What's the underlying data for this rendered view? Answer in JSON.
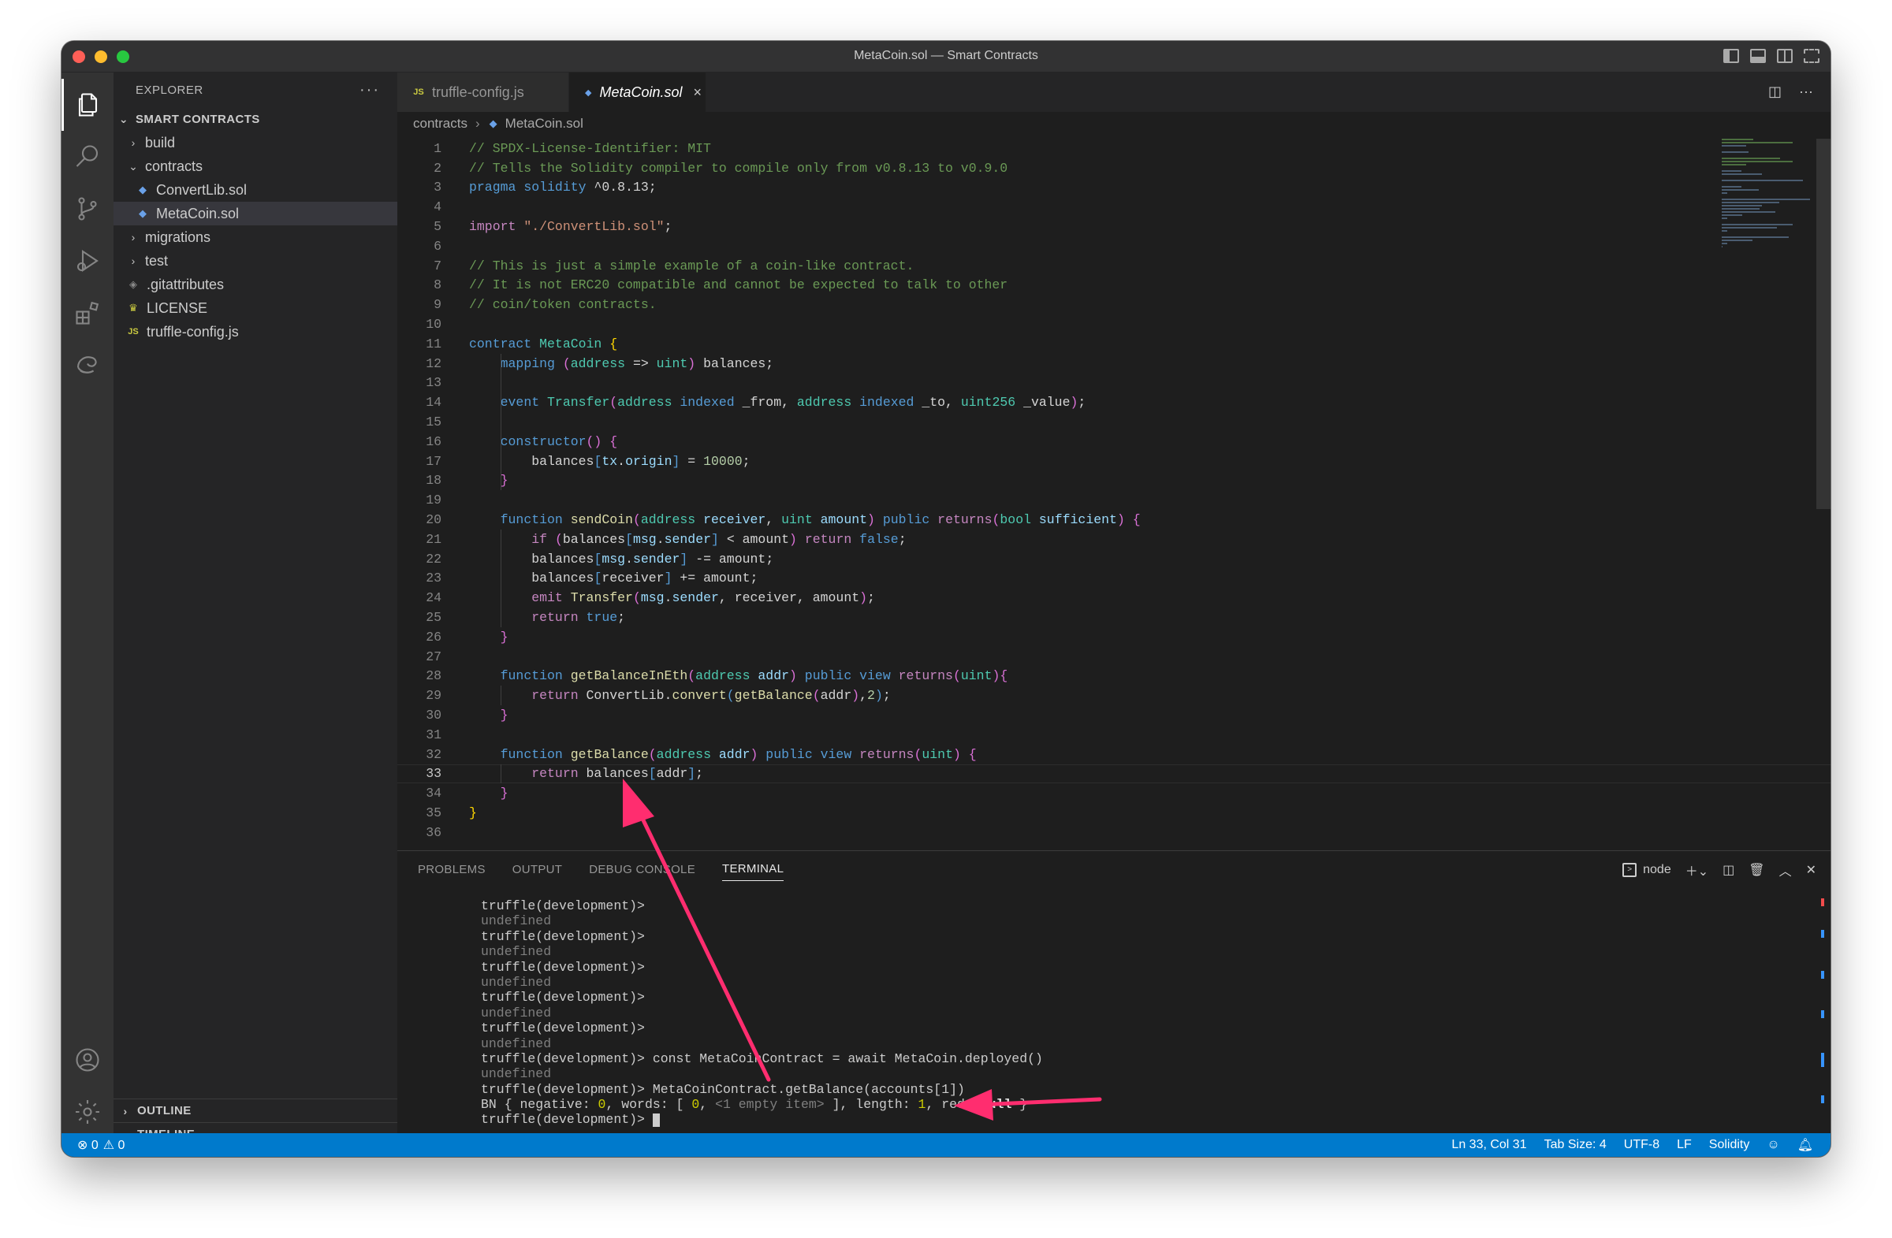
{
  "window": {
    "title": "MetaCoin.sol — Smart Contracts"
  },
  "sidebar": {
    "header": "EXPLORER",
    "more": "···",
    "section": "SMART CONTRACTS",
    "items": [
      {
        "label": "build",
        "kind": "folder",
        "expanded": false,
        "depth": 0
      },
      {
        "label": "contracts",
        "kind": "folder",
        "expanded": true,
        "depth": 0
      },
      {
        "label": "ConvertLib.sol",
        "kind": "sol",
        "depth": 1
      },
      {
        "label": "MetaCoin.sol",
        "kind": "sol",
        "depth": 1,
        "selected": true
      },
      {
        "label": "migrations",
        "kind": "folder",
        "expanded": false,
        "depth": 0
      },
      {
        "label": "test",
        "kind": "folder",
        "expanded": false,
        "depth": 0
      },
      {
        "label": ".gitattributes",
        "kind": "git",
        "depth": 0
      },
      {
        "label": "LICENSE",
        "kind": "license",
        "depth": 0
      },
      {
        "label": "truffle-config.js",
        "kind": "js",
        "depth": 0
      }
    ],
    "outline": "OUTLINE",
    "timeline": "TIMELINE"
  },
  "tabs": [
    {
      "label": "truffle-config.js",
      "icon": "JS",
      "active": false
    },
    {
      "label": "MetaCoin.sol",
      "icon": "sol",
      "active": true,
      "close": "×"
    }
  ],
  "breadcrumb": {
    "folder": "contracts",
    "file": "MetaCoin.sol"
  },
  "editor": {
    "current_line": 33,
    "lines": [
      [
        [
          "c",
          "// SPDX-License-Identifier: MIT"
        ]
      ],
      [
        [
          "c",
          "// Tells the Solidity compiler to compile only from v0.8.13 to v0.9.0"
        ]
      ],
      [
        [
          "k",
          "pragma "
        ],
        [
          "k",
          "solidity "
        ],
        [
          "p",
          "^0.8.13;"
        ]
      ],
      [],
      [
        [
          "ct",
          "import "
        ],
        [
          "s",
          "\"./ConvertLib.sol\""
        ],
        [
          "p",
          ";"
        ]
      ],
      [],
      [
        [
          "c",
          "// This is just a simple example of a coin-like contract."
        ]
      ],
      [
        [
          "c",
          "// It is not ERC20 compatible and cannot be expected to talk to other"
        ]
      ],
      [
        [
          "c",
          "// coin/token contracts."
        ]
      ],
      [],
      [
        [
          "k",
          "contract "
        ],
        [
          "t",
          "MetaCoin "
        ],
        [
          "b",
          "{"
        ]
      ],
      [
        [
          "p",
          "    "
        ],
        [
          "k",
          "mapping "
        ],
        [
          "b2",
          "("
        ],
        [
          "t",
          "address "
        ],
        [
          "p",
          "=> "
        ],
        [
          "t",
          "uint"
        ],
        [
          "b2",
          ")"
        ],
        [
          "p",
          " balances;"
        ]
      ],
      [],
      [
        [
          "p",
          "    "
        ],
        [
          "k",
          "event "
        ],
        [
          "t",
          "Transfer"
        ],
        [
          "b2",
          "("
        ],
        [
          "t",
          "address "
        ],
        [
          "k",
          "indexed "
        ],
        [
          "p",
          "_from, "
        ],
        [
          "t",
          "address "
        ],
        [
          "k",
          "indexed "
        ],
        [
          "p",
          "_to, "
        ],
        [
          "t",
          "uint256 "
        ],
        [
          "p",
          "_value"
        ],
        [
          "b2",
          ")"
        ],
        [
          "p",
          ";"
        ]
      ],
      [],
      [
        [
          "p",
          "    "
        ],
        [
          "k",
          "constructor"
        ],
        [
          "b2",
          "() {"
        ]
      ],
      [
        [
          "p",
          "        balances"
        ],
        [
          "k",
          "["
        ],
        [
          "v",
          "tx"
        ],
        [
          "p",
          "."
        ],
        [
          "v",
          "origin"
        ],
        [
          "k",
          "]"
        ],
        [
          "p",
          " = "
        ],
        [
          "n",
          "10000"
        ],
        [
          "p",
          ";"
        ]
      ],
      [
        [
          "p",
          "    "
        ],
        [
          "b2",
          "}"
        ]
      ],
      [],
      [
        [
          "p",
          "    "
        ],
        [
          "k",
          "function "
        ],
        [
          "f",
          "sendCoin"
        ],
        [
          "b2",
          "("
        ],
        [
          "t",
          "address "
        ],
        [
          "v",
          "receiver"
        ],
        [
          "p",
          ", "
        ],
        [
          "t",
          "uint "
        ],
        [
          "v",
          "amount"
        ],
        [
          "b2",
          ")"
        ],
        [
          "k",
          " public "
        ],
        [
          "ct",
          "returns"
        ],
        [
          "b2",
          "("
        ],
        [
          "t",
          "bool "
        ],
        [
          "v",
          "sufficient"
        ],
        [
          "b2",
          ")"
        ],
        [
          "b2",
          " {"
        ]
      ],
      [
        [
          "p",
          "        "
        ],
        [
          "ct",
          "if "
        ],
        [
          "b2",
          "("
        ],
        [
          "p",
          "balances"
        ],
        [
          "k",
          "["
        ],
        [
          "v",
          "msg"
        ],
        [
          "p",
          "."
        ],
        [
          "v",
          "sender"
        ],
        [
          "k",
          "]"
        ],
        [
          "p",
          " < amount"
        ],
        [
          "b2",
          ")"
        ],
        [
          "ct",
          " return "
        ],
        [
          "k",
          "false"
        ],
        [
          "p",
          ";"
        ]
      ],
      [
        [
          "p",
          "        balances"
        ],
        [
          "k",
          "["
        ],
        [
          "v",
          "msg"
        ],
        [
          "p",
          "."
        ],
        [
          "v",
          "sender"
        ],
        [
          "k",
          "]"
        ],
        [
          "p",
          " -= amount;"
        ]
      ],
      [
        [
          "p",
          "        balances"
        ],
        [
          "k",
          "["
        ],
        [
          "p",
          "receiver"
        ],
        [
          "k",
          "]"
        ],
        [
          "p",
          " += amount;"
        ]
      ],
      [
        [
          "p",
          "        "
        ],
        [
          "ct",
          "emit "
        ],
        [
          "f",
          "Transfer"
        ],
        [
          "b2",
          "("
        ],
        [
          "v",
          "msg"
        ],
        [
          "p",
          "."
        ],
        [
          "v",
          "sender"
        ],
        [
          "p",
          ", receiver, amount"
        ],
        [
          "b2",
          ")"
        ],
        [
          "p",
          ";"
        ]
      ],
      [
        [
          "p",
          "        "
        ],
        [
          "ct",
          "return "
        ],
        [
          "k",
          "true"
        ],
        [
          "p",
          ";"
        ]
      ],
      [
        [
          "p",
          "    "
        ],
        [
          "b2",
          "}"
        ]
      ],
      [],
      [
        [
          "p",
          "    "
        ],
        [
          "k",
          "function "
        ],
        [
          "f",
          "getBalanceInEth"
        ],
        [
          "b2",
          "("
        ],
        [
          "t",
          "address "
        ],
        [
          "v",
          "addr"
        ],
        [
          "b2",
          ")"
        ],
        [
          "k",
          " public view "
        ],
        [
          "ct",
          "returns"
        ],
        [
          "b2",
          "("
        ],
        [
          "t",
          "uint"
        ],
        [
          "b2",
          ")"
        ],
        [
          "b2",
          "{"
        ]
      ],
      [
        [
          "p",
          "        "
        ],
        [
          "ct",
          "return "
        ],
        [
          "p",
          "ConvertLib."
        ],
        [
          "f",
          "convert"
        ],
        [
          "k",
          "("
        ],
        [
          "f",
          "getBalance"
        ],
        [
          "b2",
          "("
        ],
        [
          "p",
          "addr"
        ],
        [
          "b2",
          ")"
        ],
        [
          "p",
          ","
        ],
        [
          "n",
          "2"
        ],
        [
          "k",
          ")"
        ],
        [
          "p",
          ";"
        ]
      ],
      [
        [
          "p",
          "    "
        ],
        [
          "b2",
          "}"
        ]
      ],
      [],
      [
        [
          "p",
          "    "
        ],
        [
          "k",
          "function "
        ],
        [
          "f",
          "getBalance"
        ],
        [
          "b2",
          "("
        ],
        [
          "t",
          "address "
        ],
        [
          "v",
          "addr"
        ],
        [
          "b2",
          ")"
        ],
        [
          "k",
          " public view "
        ],
        [
          "ct",
          "returns"
        ],
        [
          "b2",
          "("
        ],
        [
          "t",
          "uint"
        ],
        [
          "b2",
          ")"
        ],
        [
          "b2",
          " {"
        ]
      ],
      [
        [
          "p",
          "        "
        ],
        [
          "ct",
          "return "
        ],
        [
          "p",
          "balances"
        ],
        [
          "k",
          "["
        ],
        [
          "p",
          "addr"
        ],
        [
          "k",
          "]"
        ],
        [
          "p",
          ";"
        ]
      ],
      [
        [
          "p",
          "    "
        ],
        [
          "b2",
          "}"
        ]
      ],
      [
        [
          "b",
          "}"
        ]
      ],
      []
    ]
  },
  "panel": {
    "tabs": [
      "PROBLEMS",
      "OUTPUT",
      "DEBUG CONSOLE",
      "TERMINAL"
    ],
    "active_tab": "TERMINAL",
    "shell": "node",
    "terminal_lines": [
      "truffle(development)>",
      "undefined",
      "truffle(development)>",
      "undefined",
      "truffle(development)>",
      "undefined",
      "truffle(development)>",
      "undefined",
      "truffle(development)>",
      "undefined",
      "truffle(development)> const MetaCoinContract = await MetaCoin.deployed()",
      "undefined",
      "truffle(development)> MetaCoinContract.getBalance(accounts[1])"
    ],
    "bn_result": {
      "prefix": "BN { negative: ",
      "negative": "0",
      "words_label": ", words: [ ",
      "words_first": "0",
      "words_sep": ", ",
      "empty_item": "<1 empty item>",
      "length_label": " ], length: ",
      "length": "1",
      "red_label": ", red: ",
      "red": "null",
      "suffix": " }"
    },
    "prompt": "truffle(development)> "
  },
  "statusbar": {
    "errors": "⊗ 0",
    "warnings": "⚠ 0",
    "position": "Ln 33, Col 31",
    "tab_size": "Tab Size: 4",
    "encoding": "UTF-8",
    "eol": "LF",
    "language": "Solidity"
  },
  "colors": {
    "accent": "#007acc",
    "annotation": "#ff2d6f"
  }
}
